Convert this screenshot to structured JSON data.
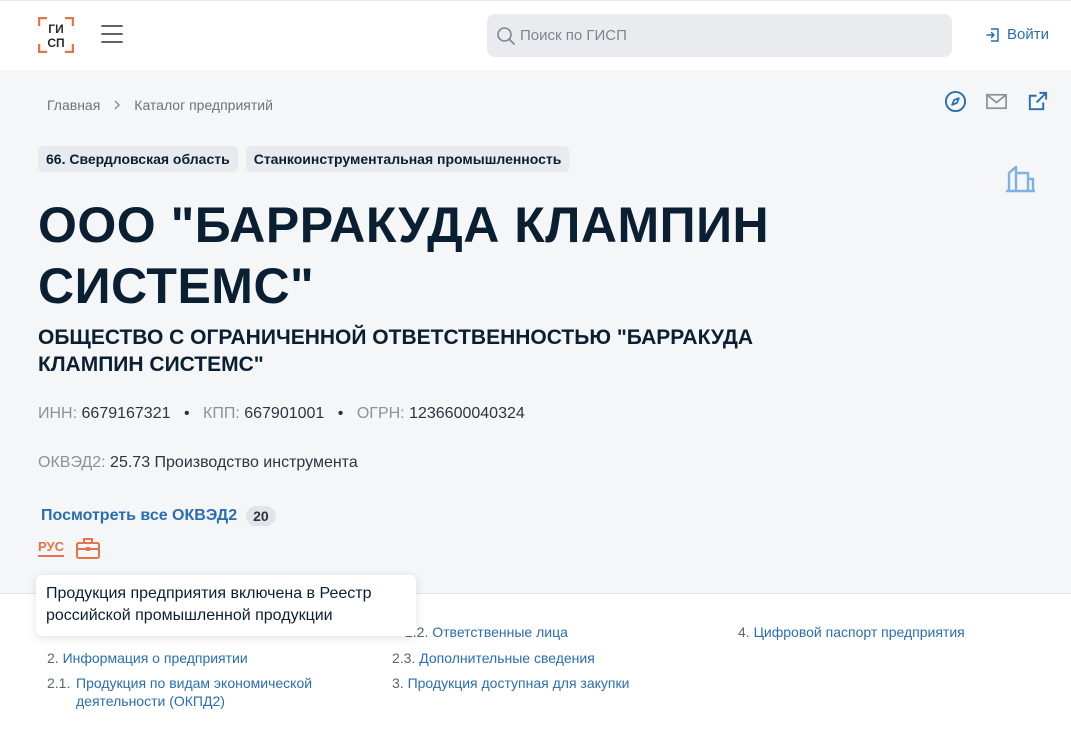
{
  "header": {
    "logo_top": "ГИ",
    "logo_bottom": "СП",
    "search_placeholder": "Поиск по ГИСП",
    "login_label": "Войти"
  },
  "breadcrumb": {
    "home": "Главная",
    "catalog": "Каталог предприятий"
  },
  "tags": {
    "region": "66. Свердловская область",
    "industry": "Станкоинструментальная промышленность"
  },
  "company": {
    "short_name": "ООО \"БАРРАКУДА КЛАМПИН СИСТЕМС\"",
    "full_name": "ОБЩЕСТВО С ОГРАНИЧЕННОЙ ОТВЕТСТВЕННОСТЬЮ \"БАРРАКУДА КЛАМПИН СИСТЕМС\"",
    "inn_label": "ИНН:",
    "inn": "6679167321",
    "kpp_label": "КПП:",
    "kpp": "667901001",
    "ogrn_label": "ОГРН:",
    "ogrn": "1236600040324",
    "okved_label": "ОКВЭД2:",
    "okved_value": "25.73 Производство инструмента",
    "okved_link": "Посмотреть все ОКВЭД2",
    "okved_count": "20",
    "rus_badge": "РУС"
  },
  "tooltip": {
    "text": "Продукция предприятия включена в Реестр российской промышленной продукции"
  },
  "toc": {
    "item_2_2": {
      "num": "2.2.",
      "label": "Ответственные лица"
    },
    "item_4": {
      "num": "4.",
      "label": "Цифровой паспорт предприятия"
    },
    "item_2": {
      "num": "2.",
      "label": "Информация о предприятии"
    },
    "item_2_3": {
      "num": "2.3.",
      "label": "Дополнительные сведения"
    },
    "item_2_1": {
      "num": "2.1.",
      "label": "Продукция по видам экономической деятельности (ОКПД2)"
    },
    "item_3": {
      "num": "3.",
      "label": "Продукция доступная для закупки"
    }
  },
  "colors": {
    "accent": "#2a6eb1",
    "logo_dark": "#2b2b2b",
    "logo_accent": "#e4744a",
    "badge": "#e4744a",
    "bg_gray": "#f4f6f8"
  },
  "icons": [
    "burger-menu-icon",
    "search-icon",
    "login-icon",
    "chevron-right-icon",
    "compass-icon",
    "mail-icon",
    "external-link-icon",
    "building-icon",
    "briefcase-icon"
  ]
}
